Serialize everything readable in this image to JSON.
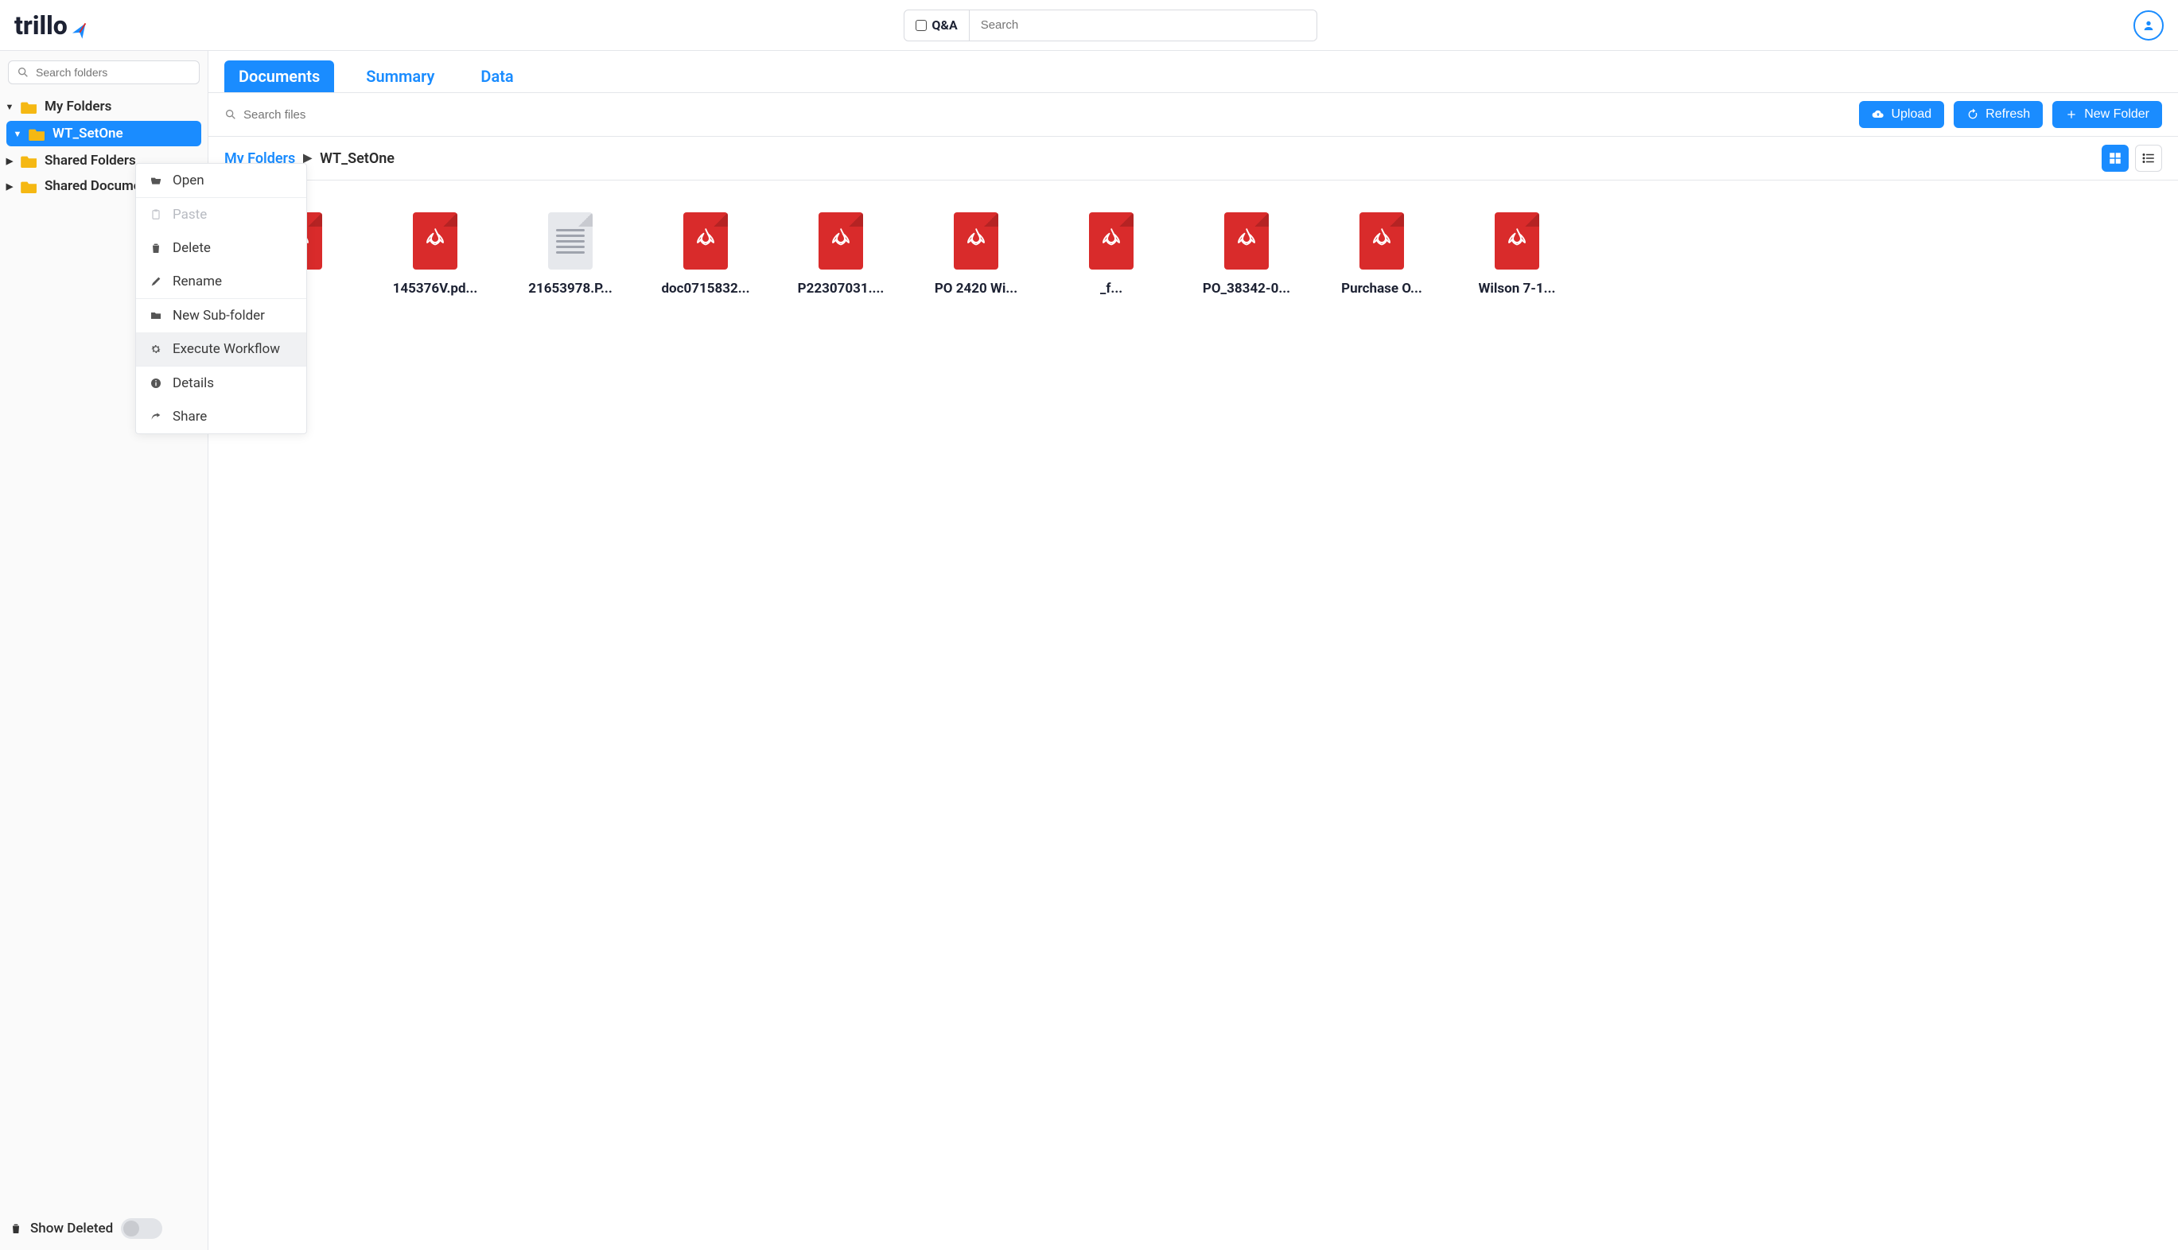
{
  "app": {
    "name": "trillo"
  },
  "header": {
    "qa_label": "Q&A",
    "search_placeholder": "Search"
  },
  "sidebar": {
    "search_placeholder": "Search folders",
    "tree": [
      {
        "label": "My Folders",
        "expanded": true,
        "level": 0
      },
      {
        "label": "WT_SetOne",
        "expanded": true,
        "level": 1,
        "selected": true
      },
      {
        "label": "Shared Folders",
        "expanded": false,
        "level": 0
      },
      {
        "label": "Shared Documents",
        "expanded": false,
        "level": 0
      }
    ],
    "show_deleted_label": "Show Deleted"
  },
  "content": {
    "tabs": [
      {
        "label": "Documents",
        "active": true
      },
      {
        "label": "Summary",
        "active": false
      },
      {
        "label": "Data",
        "active": false
      }
    ],
    "search_placeholder": "Search files",
    "actions": {
      "upload": "Upload",
      "refresh": "Refresh",
      "new_folder": "New Folder"
    },
    "breadcrumb": {
      "root": "My Folders",
      "current": "WT_SetOne"
    },
    "files": [
      {
        "name": "...",
        "display": "...",
        "type": "pdf"
      },
      {
        "name": "145376V.pdf",
        "display": "145376V.pd...",
        "type": "pdf"
      },
      {
        "name": "21653978.P...",
        "display": "21653978.P...",
        "type": "txt"
      },
      {
        "name": "doc0715832...",
        "display": "doc0715832...",
        "type": "pdf"
      },
      {
        "name": "P22307031....",
        "display": "P22307031....",
        "type": "pdf"
      },
      {
        "name": "PO 2420 Wi...",
        "display": "PO 2420 Wi...",
        "type": "pdf"
      },
      {
        "name": "..._f...",
        "display": "_f...",
        "type": "pdf"
      },
      {
        "name": "PO_38342-0...",
        "display": "PO_38342-0...",
        "type": "pdf"
      },
      {
        "name": "Purchase O...",
        "display": "Purchase O...",
        "type": "pdf"
      },
      {
        "name": "Wilson 7-1...",
        "display": "Wilson 7-1...",
        "type": "pdf"
      }
    ]
  },
  "context_menu": {
    "groups": [
      [
        {
          "label": "Open",
          "icon": "open-icon"
        }
      ],
      [
        {
          "label": "Paste",
          "icon": "paste-icon",
          "disabled": true
        },
        {
          "label": "Delete",
          "icon": "trash-icon"
        },
        {
          "label": "Rename",
          "icon": "pencil-icon"
        }
      ],
      [
        {
          "label": "New Sub-folder",
          "icon": "folder-icon"
        },
        {
          "label": "Execute Workflow",
          "icon": "gear-icon",
          "highlight": true
        }
      ],
      [
        {
          "label": "Details",
          "icon": "info-icon"
        },
        {
          "label": "Share",
          "icon": "share-icon"
        }
      ]
    ]
  }
}
